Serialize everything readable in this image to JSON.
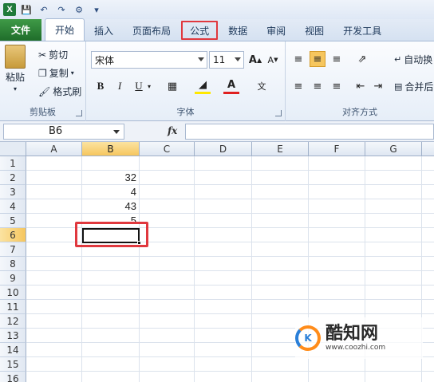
{
  "qat": {
    "icons": [
      "excel-logo",
      "save-icon",
      "undo-icon",
      "redo-icon",
      "customize-icon"
    ]
  },
  "tabs": [
    {
      "label": "文件"
    },
    {
      "label": "开始"
    },
    {
      "label": "插入"
    },
    {
      "label": "页面布局"
    },
    {
      "label": "公式"
    },
    {
      "label": "数据"
    },
    {
      "label": "审阅"
    },
    {
      "label": "视图"
    },
    {
      "label": "开发工具"
    }
  ],
  "ribbon": {
    "clipboard": {
      "label": "剪贴板",
      "paste": "粘贴",
      "cut": "剪切",
      "copy": "复制",
      "format_painter": "格式刷"
    },
    "font": {
      "label": "字体",
      "font_name": "宋体",
      "font_size": "11",
      "bold": "B",
      "italic": "I",
      "underline": "U",
      "grow": "A",
      "shrink": "A"
    },
    "alignment": {
      "label": "对齐方式",
      "wrap_text": "自动换",
      "merge": "合并后"
    }
  },
  "formula_bar": {
    "name_box": "B6",
    "fx": "fx",
    "formula": ""
  },
  "columns": [
    "A",
    "B",
    "C",
    "D",
    "E",
    "F",
    "G"
  ],
  "rows": [
    "1",
    "2",
    "3",
    "4",
    "5",
    "6",
    "7",
    "8",
    "9",
    "10",
    "11",
    "12",
    "13",
    "14",
    "15",
    "16"
  ],
  "cells": {
    "B2": "32",
    "B3": "4",
    "B4": "43",
    "B5": "5"
  },
  "selected_cell": "B6",
  "watermark": {
    "name": "酷知网",
    "url": "www.coozhi.com"
  },
  "colors": {
    "file_tab": "#2e7d32",
    "highlight": "#e0383e",
    "selected_header": "#f6c65e"
  }
}
